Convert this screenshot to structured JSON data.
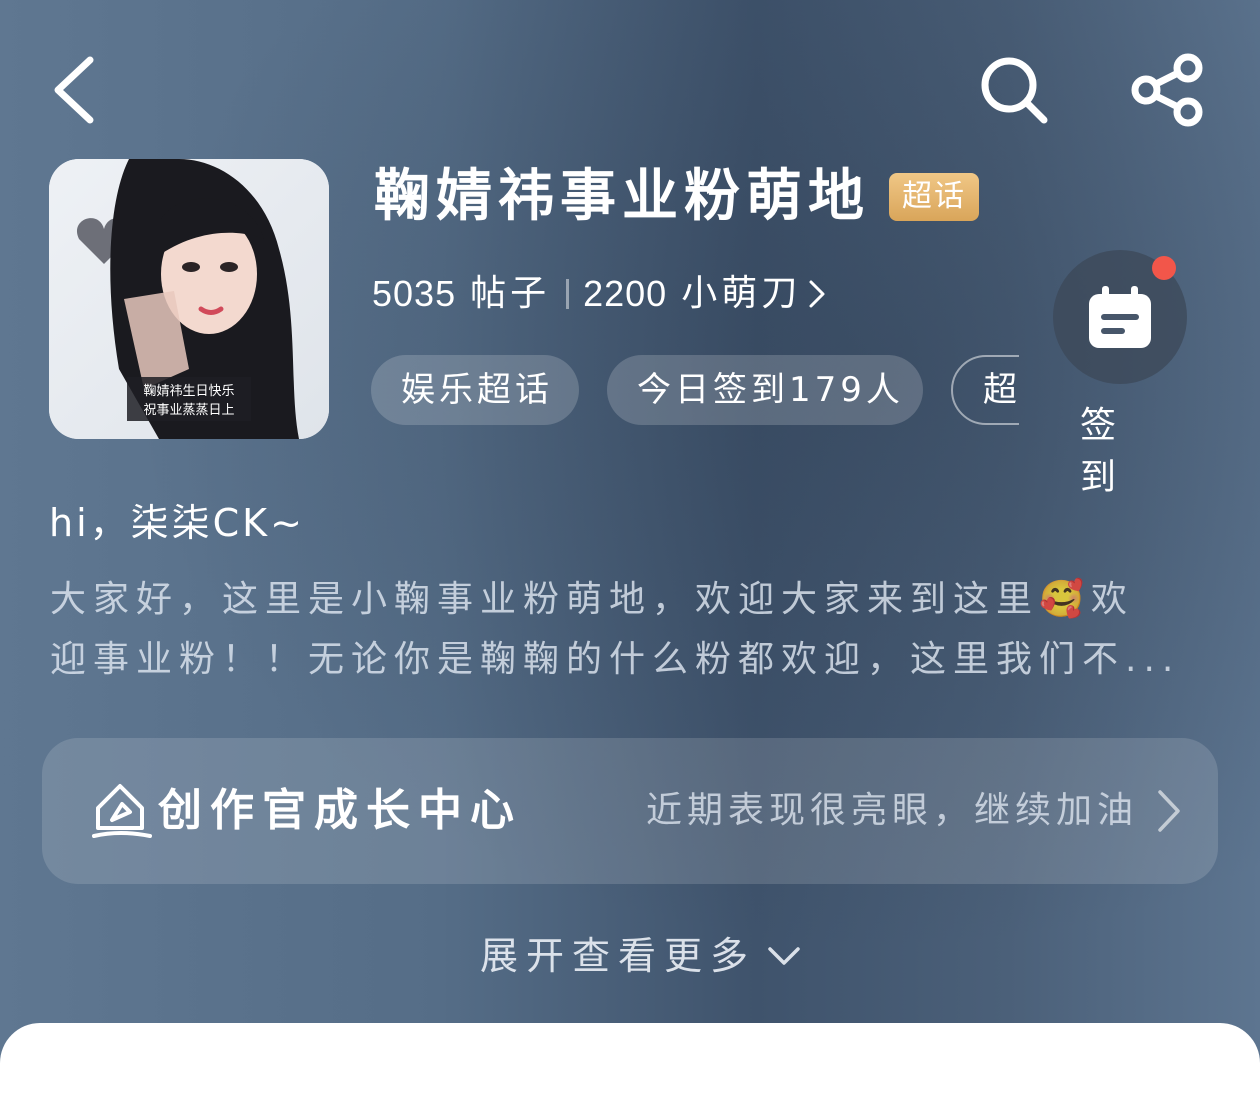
{
  "header": {
    "back_icon": "chevron-left-icon",
    "search_icon": "search-icon",
    "share_icon": "share-icon"
  },
  "community": {
    "title": "鞠婧祎事业粉萌地",
    "badge": "超话",
    "cover_caption_1": "鞠婧祎生日快乐",
    "cover_caption_2": "祝事业蒸蒸日上",
    "posts_count": "5035",
    "posts_label": "帖子",
    "members_count": "2200",
    "members_label": "小萌刀",
    "chips": [
      "娱乐超话",
      "今日签到179人",
      "超"
    ]
  },
  "checkin": {
    "label": "签到",
    "icon": "calendar-icon",
    "has_notification": true
  },
  "intro": {
    "greeting": "hi，柒柒CK~",
    "text_line_1": "大家好，这里是小鞠事业粉萌地，欢迎大家来到这里🥰欢",
    "text_line_2": "迎事业粉！！无论你是鞠鞠的什么粉都欢迎，这里我们不..."
  },
  "growth_center": {
    "title": "创作官成长中心",
    "subtitle": "近期表现很亮眼，继续加油",
    "icon": "pen-house-icon"
  },
  "expand": {
    "label": "展开查看更多",
    "icon": "chevron-down-icon"
  }
}
